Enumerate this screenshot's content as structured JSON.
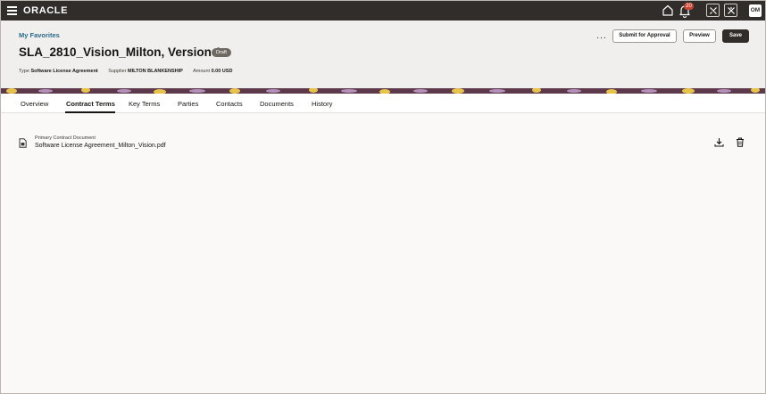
{
  "topbar": {
    "brand": "ORACLE",
    "notification_count": "20",
    "avatar_initials": "OM"
  },
  "header": {
    "favorites": "My Favorites",
    "title": "SLA_2810_Vision_Milton, Version 1",
    "status": "Draft",
    "meta": [
      {
        "label": "Type",
        "value": "Software License Agreement"
      },
      {
        "label": "Supplier",
        "value": "MILTON BLANKENSHIP"
      },
      {
        "label": "Amount",
        "value": "0.00 USD"
      }
    ],
    "more": "···",
    "submit_label": "Submit for Approval",
    "preview_label": "Preview",
    "save_label": "Save"
  },
  "tabs": [
    {
      "label": "Overview"
    },
    {
      "label": "Contract Terms"
    },
    {
      "label": "Key Terms"
    },
    {
      "label": "Parties"
    },
    {
      "label": "Contacts"
    },
    {
      "label": "Documents"
    },
    {
      "label": "History"
    }
  ],
  "active_tab": "Contract Terms",
  "document": {
    "label": "Primary Contract Document",
    "file_name": "Software License Agreement_Milton_Vision.pdf"
  },
  "colors": {
    "topbar": "#312d2a",
    "header_bg": "#f1efed",
    "link": "#2a6b8c",
    "badge": "#c74634",
    "band": "#5c3a4b"
  },
  "icons": [
    "menu-icon",
    "home-icon",
    "bell-icon",
    "tools-icon",
    "tools-alt-icon",
    "document-icon",
    "download-icon",
    "trash-icon"
  ]
}
